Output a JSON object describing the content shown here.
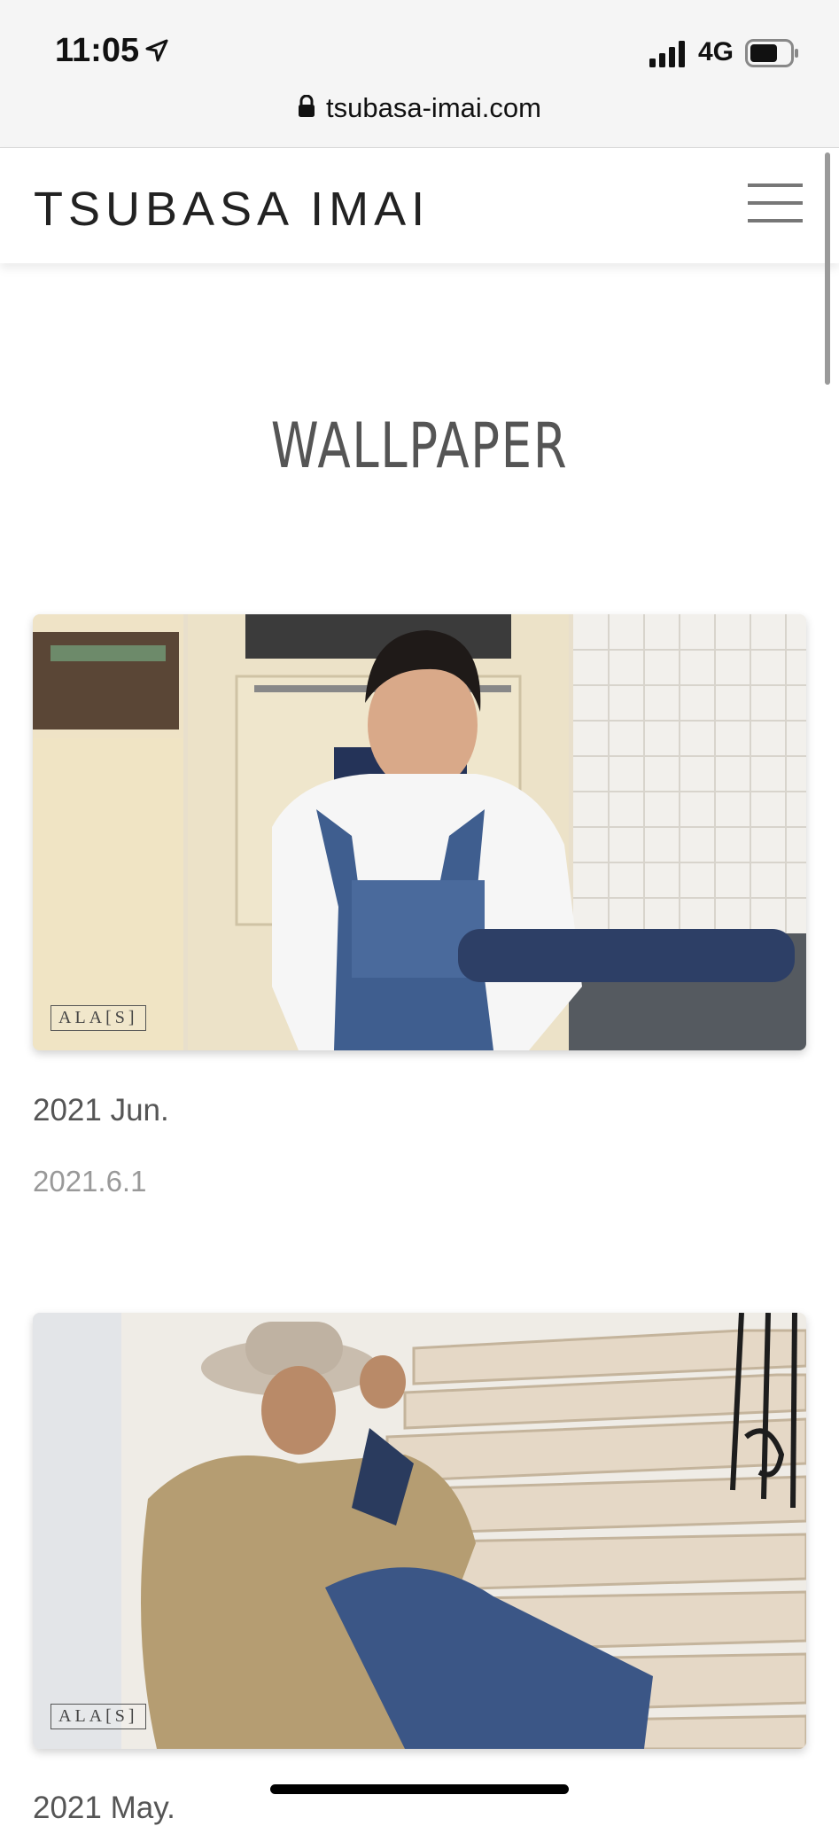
{
  "status_bar": {
    "time": "11:05",
    "network": "4G",
    "icons": [
      "location-arrow-icon",
      "signal-bars-icon",
      "battery-icon"
    ]
  },
  "browser": {
    "url": "tsubasa-imai.com",
    "icons": [
      "lock-icon"
    ]
  },
  "header": {
    "logo": "TSUBASA IMAI",
    "icons": [
      "hamburger-menu-icon"
    ]
  },
  "page": {
    "title": "WALLPAPER"
  },
  "wallpapers": [
    {
      "title": "2021 Jun.",
      "date": "2021.6.1",
      "watermark": "ALA[S]"
    },
    {
      "title": "2021 May.",
      "watermark": "ALA[S]"
    }
  ],
  "colors": {
    "status_bg": "#f5f5f5",
    "logo": "#222222",
    "title": "#555555",
    "date": "#999999"
  }
}
